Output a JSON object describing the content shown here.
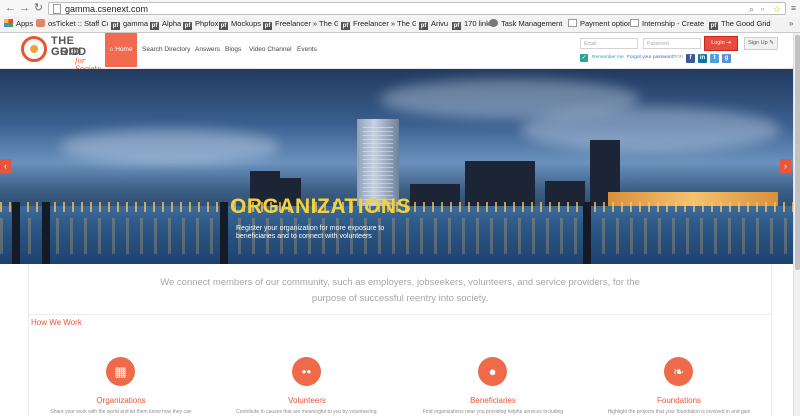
{
  "browser": {
    "url": "gamma.csenext.com",
    "bookmarks": [
      {
        "label": "Apps",
        "icon": "apps-grid-icon"
      },
      {
        "label": "osTicket :: Staff Con...",
        "icon": "ticket-icon"
      },
      {
        "label": "gamma",
        "icon": "pf-icon"
      },
      {
        "label": "Alpha",
        "icon": "pf-icon"
      },
      {
        "label": "Phpfox",
        "icon": "pf-icon"
      },
      {
        "label": "Mockups",
        "icon": "pf-icon"
      },
      {
        "label": "Freelancer » The Go...",
        "icon": "pf-icon"
      },
      {
        "label": "Freelancer » The Go...",
        "icon": "pf-icon"
      },
      {
        "label": "Arivu",
        "icon": "pf-icon"
      },
      {
        "label": "170 link",
        "icon": "pf-icon"
      },
      {
        "label": "Task Management S...",
        "icon": "task-icon"
      },
      {
        "label": "Payment options",
        "icon": "page-icon"
      },
      {
        "label": "Internship - Create ...",
        "icon": "page-icon"
      },
      {
        "label": "The Good Grid",
        "icon": "pf-icon"
      }
    ],
    "more": "»"
  },
  "site": {
    "logo": {
      "line1": "THE GOOD",
      "line2": "GRID",
      "tagline": "for Society"
    },
    "nav": {
      "home": "Home",
      "items": [
        "Search Directory",
        "Answers",
        "Blogs",
        "Video Channel",
        "Events"
      ]
    },
    "login": {
      "email_placeholder": "Email",
      "password_placeholder": "Password",
      "login_label": "Login",
      "signup_label": "Sign Up",
      "remember_label": "Remember me",
      "forgot_label": "Forgot your password?",
      "or_label": "OR"
    },
    "social": [
      {
        "name": "facebook",
        "glyph": "f",
        "color": "#3b5998"
      },
      {
        "name": "linkedin",
        "glyph": "in",
        "color": "#0e76a8"
      },
      {
        "name": "twitter",
        "glyph": "t",
        "color": "#4aa3df"
      },
      {
        "name": "google",
        "glyph": "g",
        "color": "#5b8fd6"
      }
    ]
  },
  "hero": {
    "title": "ORGANIZATIONS",
    "subtitle": "Register your organization for more exposure to beneficiaries and to connect with volunteers",
    "prev": "‹",
    "next": "›"
  },
  "intro": {
    "text": "We connect members of our community, such as employers, jobseekers, volunteers, and service providers, for the purpose of successful reentry into society."
  },
  "how_we_work": {
    "label": "How We Work",
    "cards": [
      {
        "title": "Organizations",
        "text": "Share your work with the world and let them know how they can",
        "icon": "building-icon",
        "glyph": "▦"
      },
      {
        "title": "Volunteers",
        "text": "Contribute to causes that are meaningful to you by volunteering,",
        "icon": "people-icon",
        "glyph": "●●"
      },
      {
        "title": "Beneficiaries",
        "text": "Find organizations near you providing helpful services including",
        "icon": "person-icon",
        "glyph": "●"
      },
      {
        "title": "Foundations",
        "text": "Highlight the projects that your foundation is involved in and gain",
        "icon": "leaf-icon",
        "glyph": "❧"
      }
    ]
  },
  "colors": {
    "accent": "#e8553b",
    "hero_title": "#f4d23a",
    "login": "#e94b3c",
    "check": "#25a89a"
  }
}
